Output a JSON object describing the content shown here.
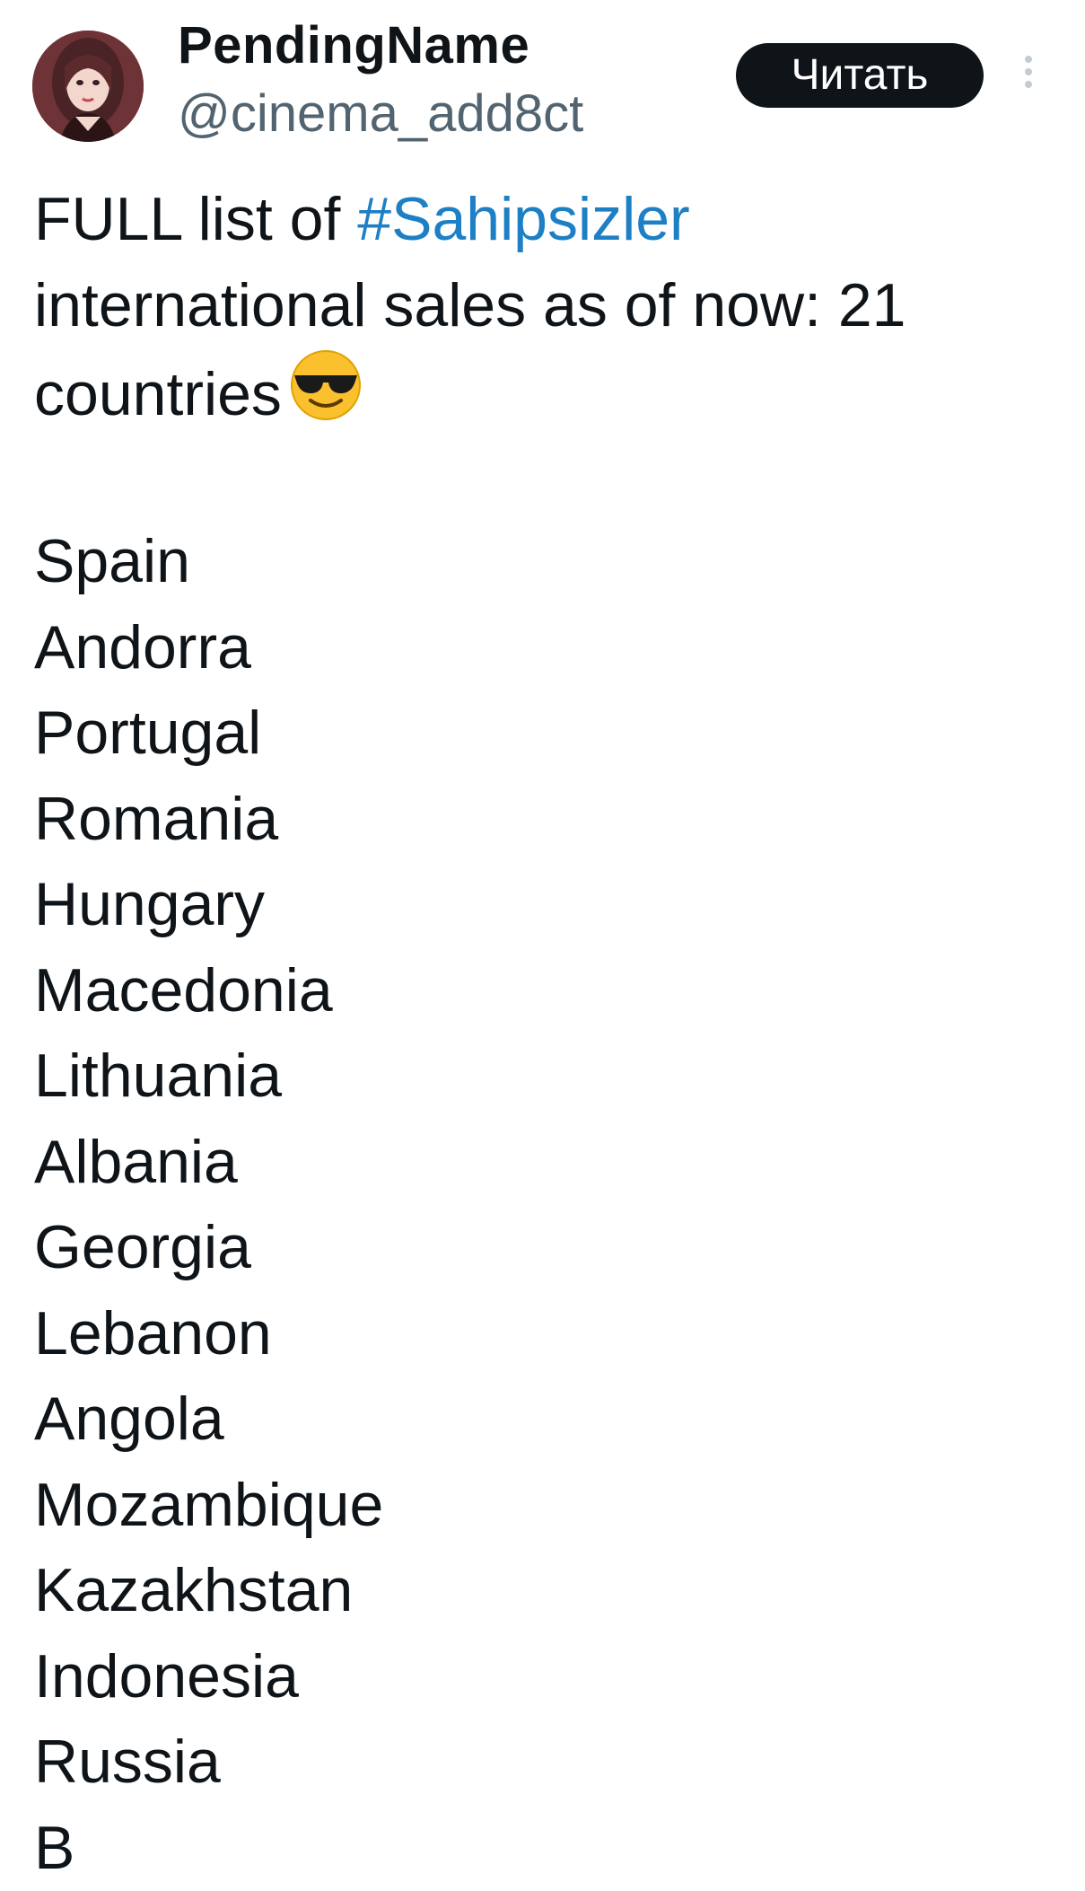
{
  "author": {
    "display_name": "PendingName",
    "handle": "@cinema_add8ct"
  },
  "follow_button_label": "Читать",
  "more_icon": "more-vertical-icon",
  "tweet": {
    "text_before": "FULL list of ",
    "hashtag": "#Sahipsizler",
    "text_line2": "international sales as of now: 21",
    "text_line3": "countries",
    "emoji": "smiling-face-with-sunglasses",
    "countries": [
      "Spain",
      "Andorra",
      "Portugal",
      "Romania",
      "Hungary",
      "Macedonia",
      "Lithuania",
      "Albania",
      "Georgia",
      "Lebanon",
      "Angola",
      "Mozambique",
      "Kazakhstan",
      "Indonesia",
      "Russia",
      "B"
    ]
  },
  "colors": {
    "text": "#0f1419",
    "secondary": "#536471",
    "link": "#1d7fc4",
    "button_bg": "#0f1419",
    "button_text": "#ffffff"
  }
}
